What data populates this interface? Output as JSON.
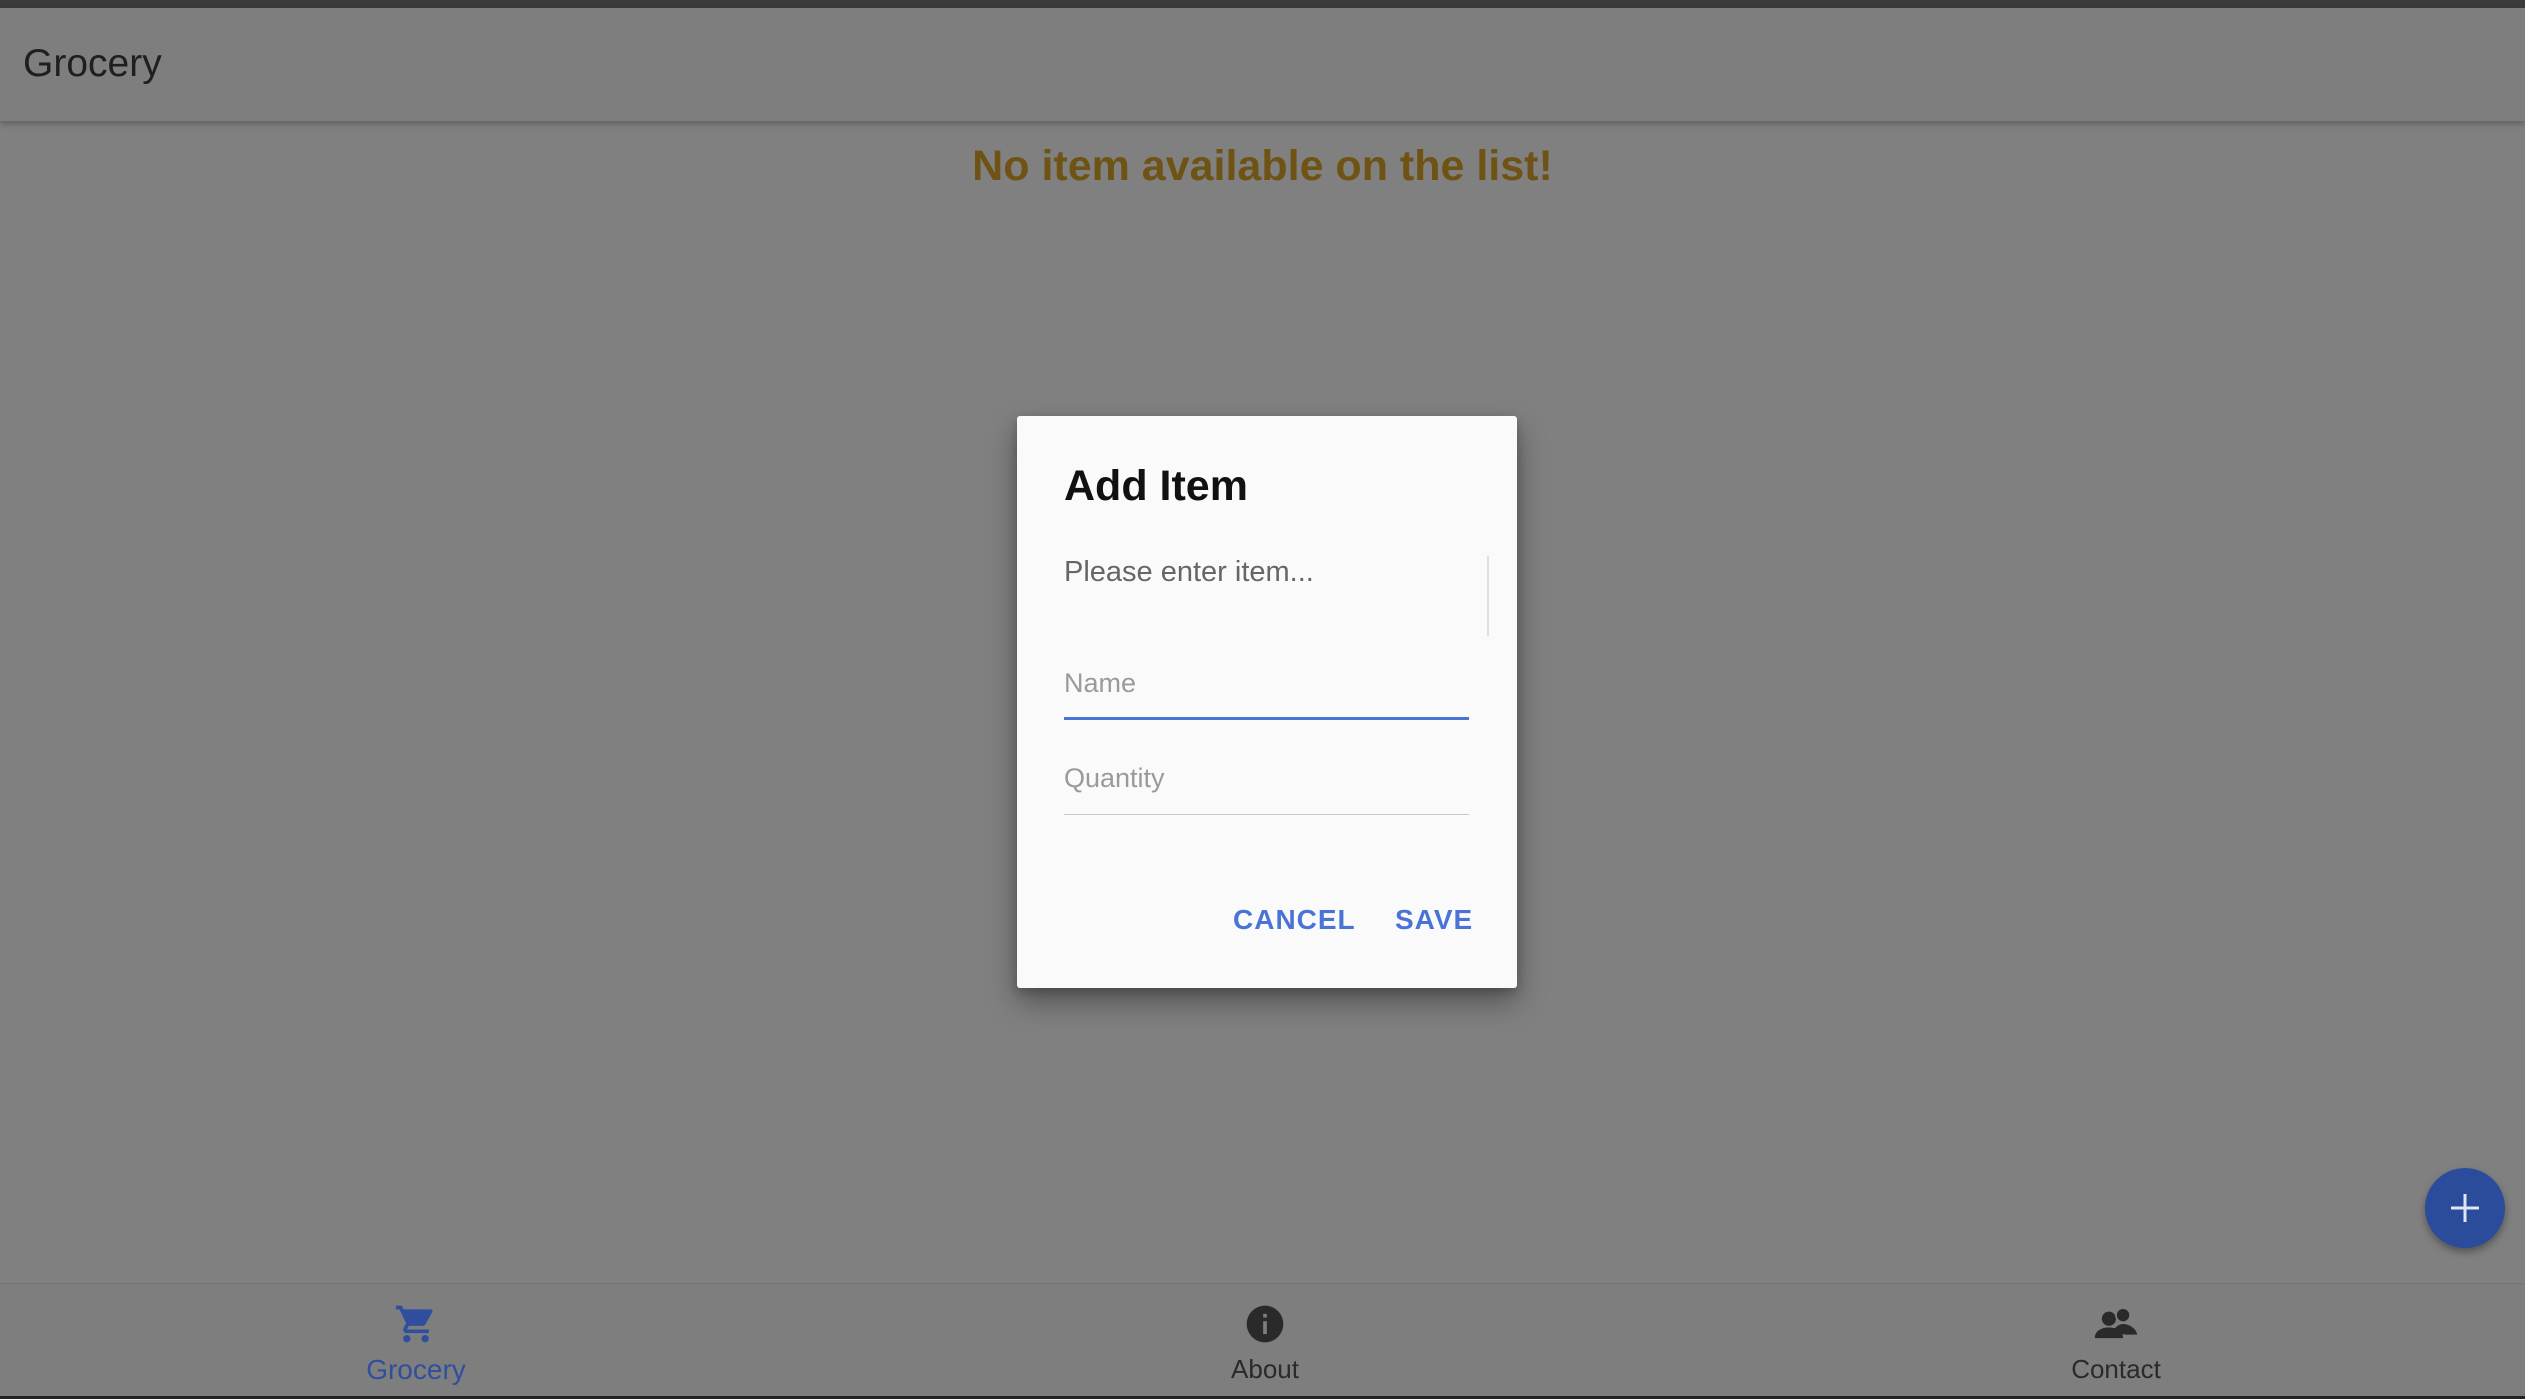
{
  "app": {
    "title": "Grocery"
  },
  "main": {
    "empty_message": "No item available on the list!"
  },
  "dialog": {
    "title": "Add Item",
    "text": "Please enter item...",
    "name_label": "Name",
    "quantity_label": "Quantity",
    "cancel_label": "CANCEL",
    "save_label": "SAVE"
  },
  "bottom_nav": {
    "items": [
      {
        "label": "Grocery",
        "icon": "shopping-cart-icon",
        "active": true
      },
      {
        "label": "About",
        "icon": "info-icon",
        "active": false
      },
      {
        "label": "Contact",
        "icon": "contacts-icon",
        "active": false
      }
    ]
  },
  "fab": {
    "icon": "plus-icon"
  },
  "colors": {
    "accent": "#4a73d6",
    "fab": "#2a4c9a",
    "empty_message": "#6e5314",
    "overlay": "#808080"
  }
}
